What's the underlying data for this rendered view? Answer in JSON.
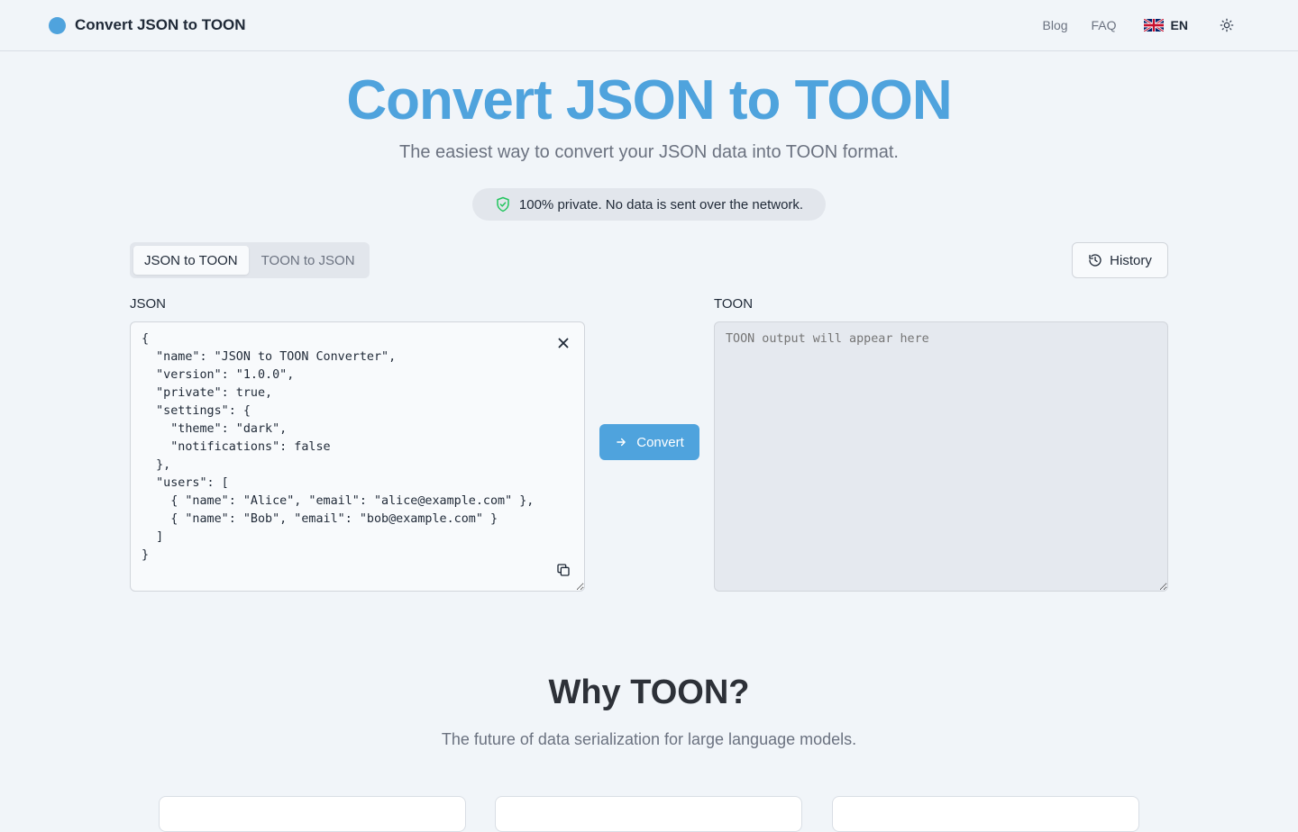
{
  "header": {
    "brand_title": "Convert JSON to TOON",
    "nav": {
      "blog": "Blog",
      "faq": "FAQ",
      "language_code": "EN",
      "language_flag_icon": "uk-flag-icon",
      "theme_icon": "sun-icon"
    }
  },
  "hero": {
    "title": "Convert JSON to TOON",
    "subtitle": "The easiest way to convert your JSON data into TOON format.",
    "privacy_note": "100% private. No data is sent over the network.",
    "privacy_icon": "shield-check-icon"
  },
  "toolbar": {
    "tabs": [
      {
        "label": "JSON to TOON",
        "active": true
      },
      {
        "label": "TOON to JSON",
        "active": false
      }
    ],
    "history_label": "History",
    "history_icon": "history-icon"
  },
  "converter": {
    "input_label": "JSON",
    "input_value": "{\n  \"name\": \"JSON to TOON Converter\",\n  \"version\": \"1.0.0\",\n  \"private\": true,\n  \"settings\": {\n    \"theme\": \"dark\",\n    \"notifications\": false\n  },\n  \"users\": [\n    { \"name\": \"Alice\", \"email\": \"alice@example.com\" },\n    { \"name\": \"Bob\", \"email\": \"bob@example.com\" }\n  ]\n}",
    "output_label": "TOON",
    "output_placeholder": "TOON output will appear here",
    "output_value": "",
    "convert_label": "Convert",
    "convert_icon": "arrow-right-icon",
    "clear_icon": "close-icon",
    "copy_icon": "copy-icon"
  },
  "why": {
    "title": "Why TOON?",
    "subtitle": "The future of data serialization for large language models."
  },
  "colors": {
    "accent": "#4fa3dd",
    "background": "#f1f5f9",
    "privacy_icon": "#22c55e"
  }
}
